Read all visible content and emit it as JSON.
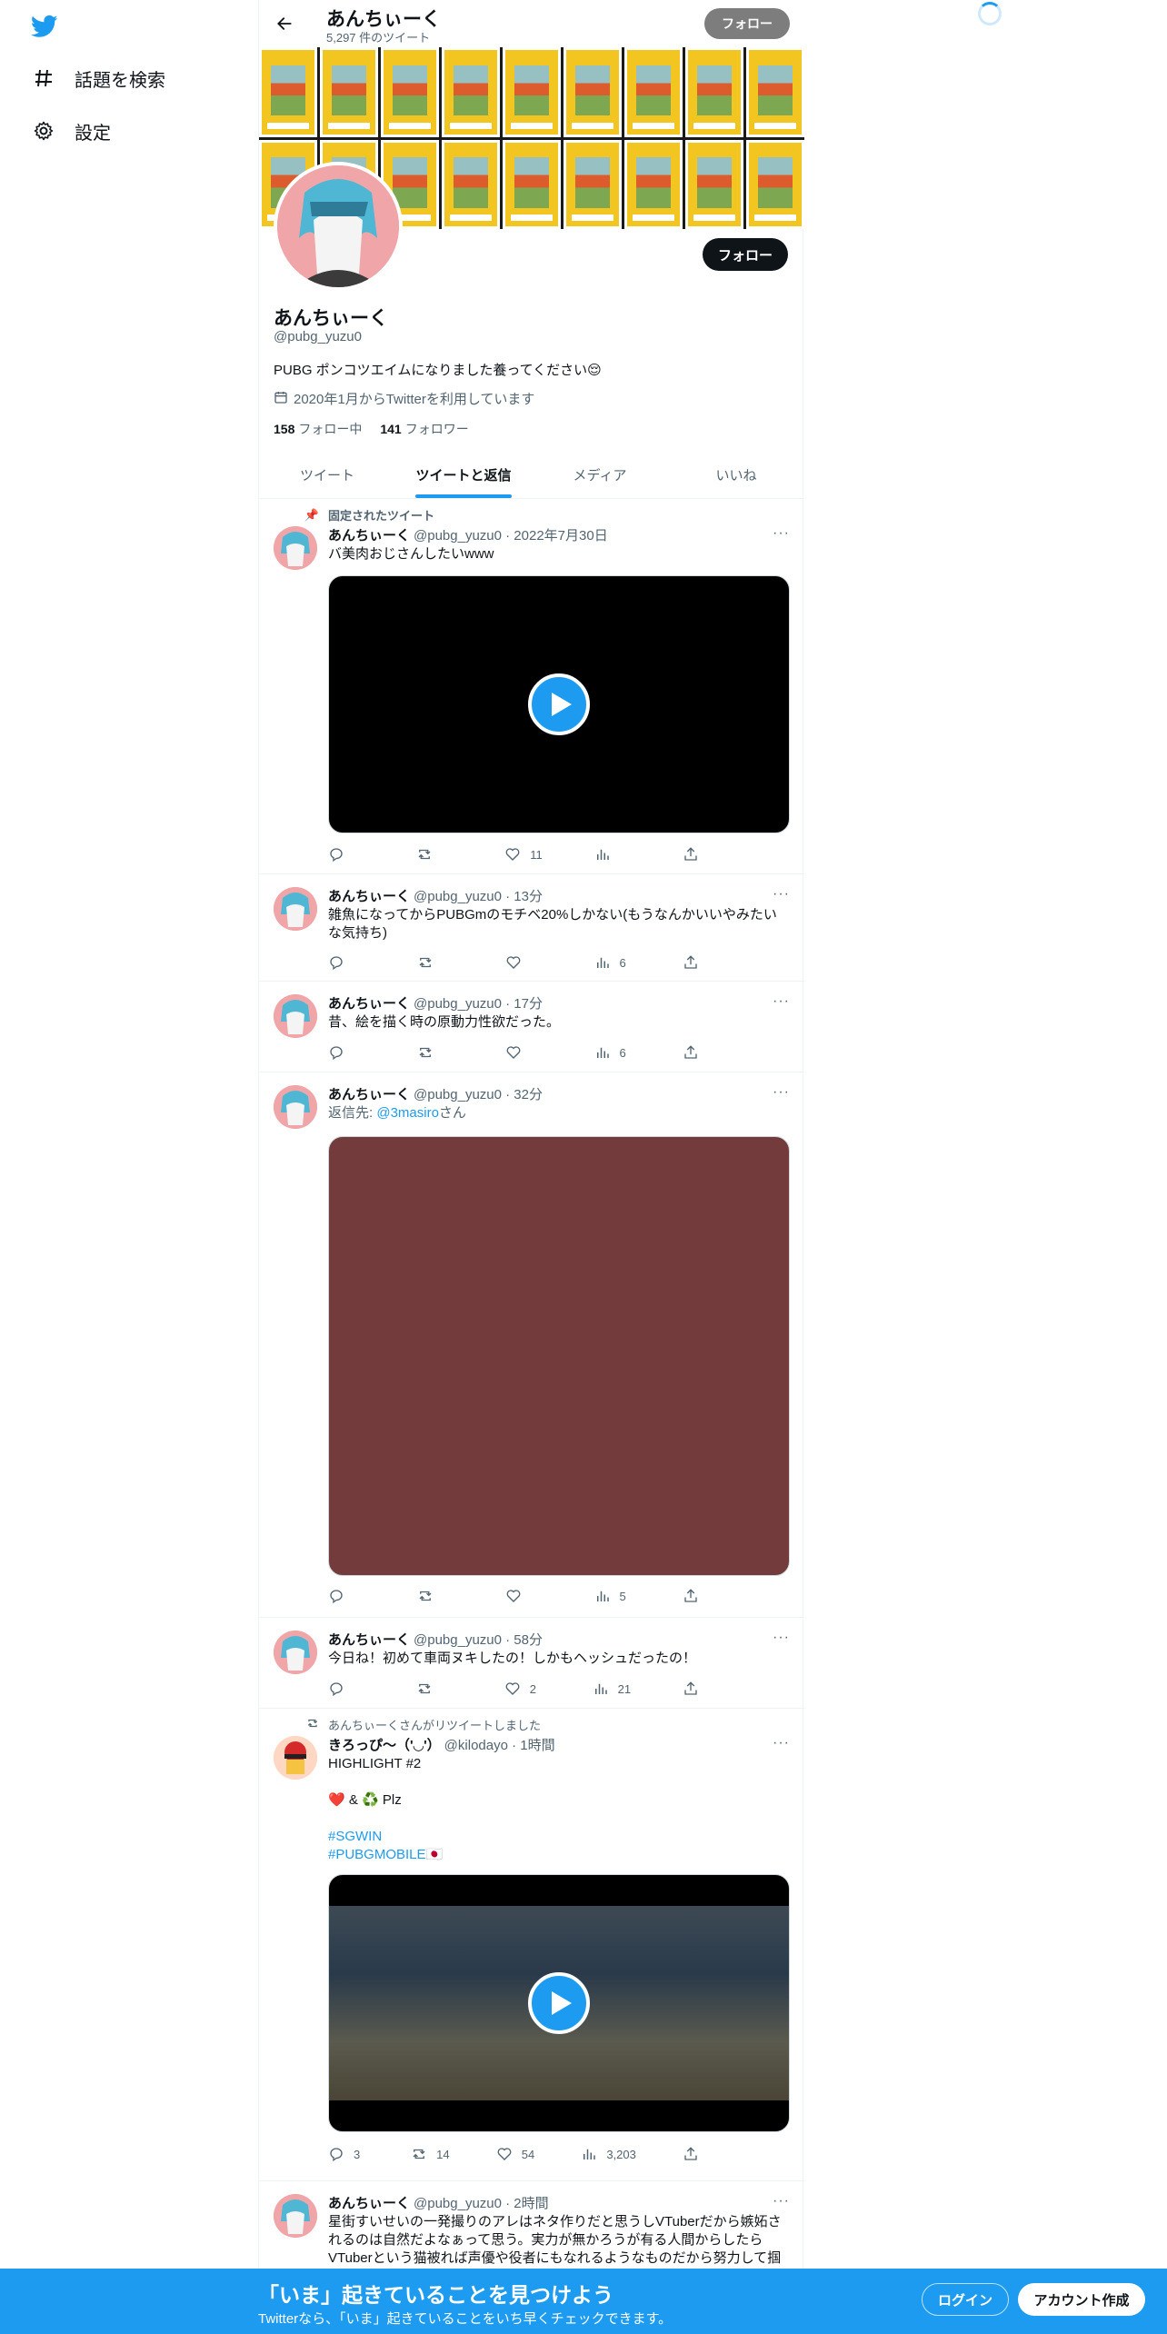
{
  "nav": {
    "items": [
      {
        "label": "話題を検索",
        "icon": "hashtag-icon"
      },
      {
        "label": "設定",
        "icon": "gear-icon"
      }
    ]
  },
  "topbar": {
    "name": "あんちぃーく",
    "tweet_count": "5,297 件のツイート",
    "follow_label": "フォロー"
  },
  "profile": {
    "name": "あんちぃーく",
    "handle": "@pubg_yuzu0",
    "bio": "PUBG ポンコツエイムになりました養ってください😌",
    "joined": "2020年1月からTwitterを利用しています",
    "following_count": "158",
    "following_label": "フォロー中",
    "followers_count": "141",
    "followers_label": "フォロワー",
    "follow_label": "フォロー"
  },
  "tabs": [
    "ツイート",
    "ツイートと返信",
    "メディア",
    "いいね"
  ],
  "tweets": [
    {
      "context": "固定されたツイート",
      "name": "あんちぃーく",
      "handle": "@pubg_yuzu0 · 2022年7月30日",
      "text": "バ美肉おじさんしたいwww",
      "reply": "",
      "retweet": "",
      "like": "11",
      "views": ""
    },
    {
      "name": "あんちぃーく",
      "handle": "@pubg_yuzu0 · 13分",
      "text": "雑魚になってからPUBGmのモチベ20%しかない(もうなんかいいやみたいな気持ち)",
      "reply": "",
      "retweet": "",
      "like": "",
      "views": "6"
    },
    {
      "name": "あんちぃーく",
      "handle": "@pubg_yuzu0 · 17分",
      "text": "昔、絵を描く時の原動力性欲だった。",
      "reply": "",
      "retweet": "",
      "like": "",
      "views": "6"
    },
    {
      "name": "あんちぃーく",
      "handle": "@pubg_yuzu0 · 32分",
      "reply_to_prefix": "返信先: ",
      "reply_to_user": "@3masiro",
      "reply_to_suffix": "さん",
      "reply": "",
      "retweet": "",
      "like": "",
      "views": "5"
    },
    {
      "name": "あんちぃーく",
      "handle": "@pubg_yuzu0 · 58分",
      "text": "今日ね！初めて車両ヌキしたの！しかもヘッシュだったの！",
      "reply": "",
      "retweet": "",
      "like": "2",
      "views": "21"
    },
    {
      "context": "あんちぃーくさんがリツイートしました",
      "name": "きろっぴ〜（'◡'）",
      "handle": "@kilodayo · 1時間",
      "text_line1": "HIGHLIGHT #2",
      "text_line2": "❤️ & ♻️ Plz",
      "hashtag1": "#SGWIN",
      "hashtag2": "#PUBGMOBILE🇯🇵",
      "reply": "3",
      "retweet": "14",
      "like": "54",
      "views": "3,203"
    },
    {
      "name": "あんちぃーく",
      "handle": "@pubg_yuzu0 · 2時間",
      "text": "星街すいせいの一発撮りのアレはネタ作りだと思うしVTuberだから嫉妬されるのは自然だよなぁって思う。実力が無かろうが有る人間からしたらVTuberという猫被れば声優や役者にもなれるようなものだから努力して掴んだ仕事を見た目で奪われるとか嫌だよな"
    }
  ],
  "bottom": {
    "title": "「いま」起きていることを見つけよう",
    "subtitle": "Twitterなら、「いま」起きていることをいち早くチェックできます。",
    "login": "ログイン",
    "signup": "アカウント作成"
  },
  "colors": {
    "accent": "#1d9bf0",
    "text": "#0f1419",
    "muted": "#536471"
  }
}
